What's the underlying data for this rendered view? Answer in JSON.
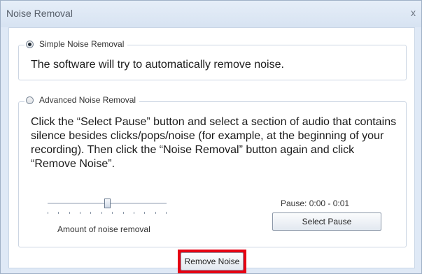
{
  "window": {
    "title": "Noise Removal",
    "close_glyph": "x"
  },
  "simple": {
    "label": "Simple Noise Removal",
    "selected": true,
    "description": "The software will try to automatically remove noise."
  },
  "advanced": {
    "label": "Advanced Noise Removal",
    "selected": false,
    "description": "Click the “Select Pause” button and select a section of audio that contains silence besides clicks/pops/noise (for example, at the beginning of your recording). Then click the “Noise Removal” button again and click “Remove Noise”."
  },
  "slider": {
    "label": "Amount of noise removal",
    "value_fraction": 0.5
  },
  "pause": {
    "label": "Pause: 0:00 - 0:01",
    "select_button": "Select Pause"
  },
  "actions": {
    "remove_noise": "Remove Noise"
  },
  "colors": {
    "highlight": "#e60012",
    "dialog_bg": "#dfe9f6"
  }
}
